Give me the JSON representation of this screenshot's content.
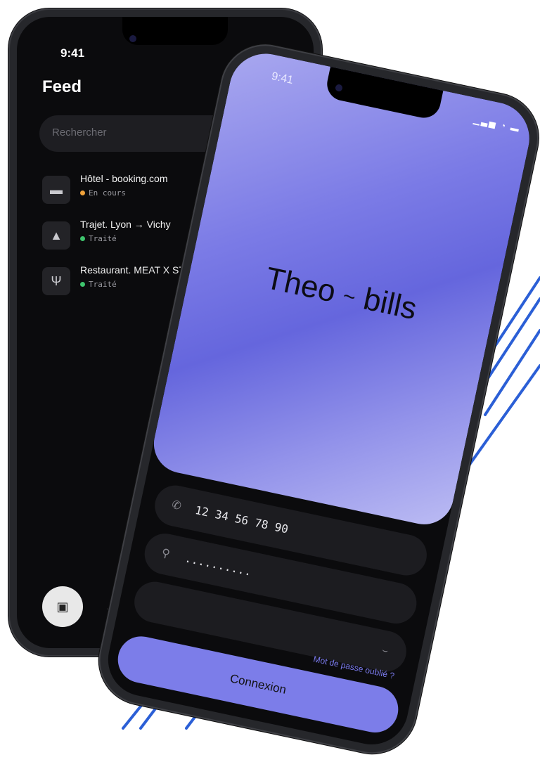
{
  "back_phone": {
    "time": "9:41",
    "status_icons": "▁▃▅ ◔ ▬",
    "title": "Feed",
    "search": {
      "placeholder": "Rechercher"
    },
    "items": [
      {
        "icon": "bed-icon",
        "glyph": "▬",
        "name": "Hôtel - booking.com",
        "status": "En cours",
        "status_color": "#f0a23a"
      },
      {
        "icon": "car-icon",
        "glyph": "▲",
        "name": "Trajet.  Lyon → Vichy",
        "status": "Traité",
        "status_color": "#3ec46d"
      },
      {
        "icon": "cutlery-icon",
        "glyph": "Ψ",
        "name": "Restaurant. MEAT X STEAK",
        "status": "Traité",
        "status_color": "#3ec46d"
      }
    ],
    "tabbar": {
      "active_glyph": "▣",
      "profile_glyph": "▴"
    }
  },
  "front_phone": {
    "time": "9:41",
    "status_icons": "▁▃▅ ◔ ▬",
    "brand_left": "Theo",
    "brand_sep": "~",
    "brand_right": "bills",
    "phone_field": {
      "icon_glyph": "✆",
      "value": "12 34 56 78 90"
    },
    "password_field": {
      "icon_glyph": "⚲",
      "value": ".........."
    },
    "confirm_field": {
      "eye_glyph": "⌣"
    },
    "forgot_link": "Mot de passe oublié ?",
    "login_button": "Connexion"
  },
  "colors": {
    "accent": "#7c7de9",
    "pending": "#f0a23a",
    "done": "#3ec46d"
  }
}
